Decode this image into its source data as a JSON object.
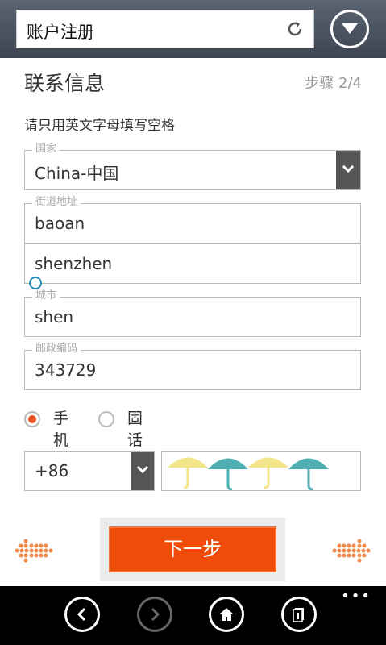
{
  "browser": {
    "address_text": "账户注册"
  },
  "page": {
    "title": "联系信息",
    "step": "步骤 2/4",
    "hint": "请只用英文字母填写空格"
  },
  "form": {
    "country": {
      "legend": "国家",
      "value": "China-中国"
    },
    "street": {
      "legend": "街道地址",
      "line1": "baoan",
      "line2": "shenzhen"
    },
    "city": {
      "legend": "城市",
      "value": "shen"
    },
    "postal": {
      "legend": "邮政编码",
      "value": "343729"
    },
    "phone_type": {
      "options": [
        "手机",
        "固话"
      ],
      "selected": "手机"
    },
    "phone_code": "+86",
    "phone_number": ""
  },
  "actions": {
    "next_label": "下一步"
  },
  "colors": {
    "accent": "#ef4c0a",
    "dark_select": "#555555"
  }
}
